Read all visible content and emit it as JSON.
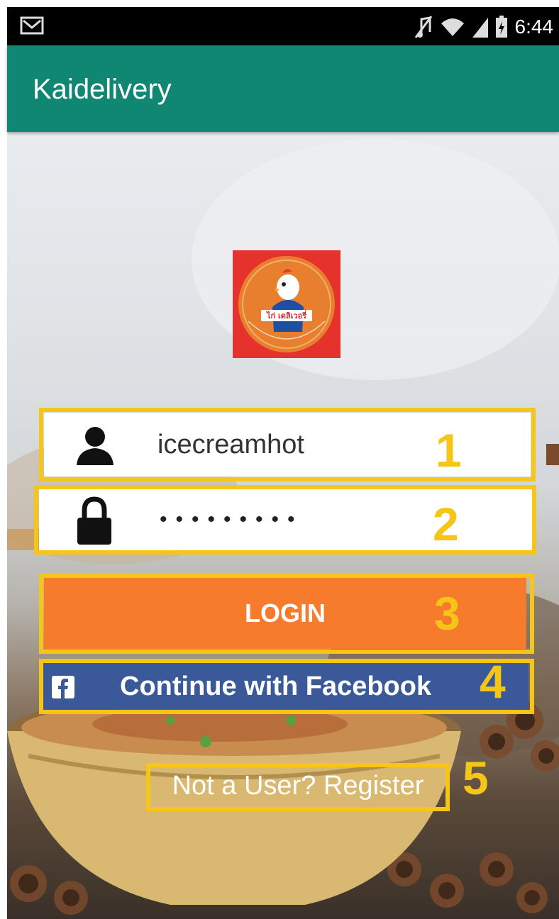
{
  "status_bar": {
    "time": "6:44",
    "icons": [
      "gmail-icon",
      "mute-icon",
      "wifi-icon",
      "cell-signal-icon",
      "battery-charging-icon"
    ]
  },
  "app_bar": {
    "title": "Kaidelivery"
  },
  "logo": {
    "label": "ไก่ เดลิเวอรี่",
    "icon": "chicken-logo-icon"
  },
  "form": {
    "username": {
      "value": "icecreamhot",
      "icon": "user-icon"
    },
    "password": {
      "value": "•••••••••",
      "icon": "lock-icon"
    },
    "login_label": "LOGIN",
    "facebook_label": "Continue with Facebook",
    "register_label": "Not a User? Register"
  },
  "annotations": [
    "1",
    "2",
    "3",
    "4",
    "5"
  ],
  "colors": {
    "app_bar": "#0f8773",
    "login_button": "#f77b2c",
    "facebook_button": "#3b5998",
    "highlight": "#f5c518",
    "logo_background": "#e5322c"
  }
}
